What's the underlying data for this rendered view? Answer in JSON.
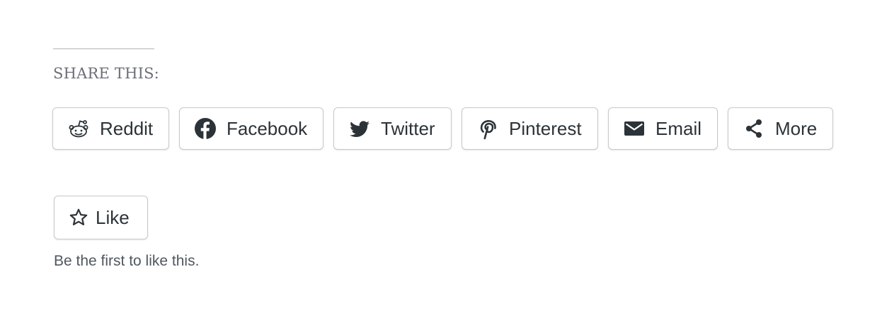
{
  "share": {
    "heading": "SHARE THIS:",
    "buttons": [
      {
        "label": "Reddit",
        "icon": "reddit-icon"
      },
      {
        "label": "Facebook",
        "icon": "facebook-icon"
      },
      {
        "label": "Twitter",
        "icon": "twitter-icon"
      },
      {
        "label": "Pinterest",
        "icon": "pinterest-icon"
      },
      {
        "label": "Email",
        "icon": "email-icon"
      },
      {
        "label": "More",
        "icon": "share-icon"
      }
    ]
  },
  "like": {
    "label": "Like",
    "icon": "star-icon",
    "note": "Be the first to like this."
  },
  "colors": {
    "text": "#2c3338",
    "heading": "#6b6f78",
    "border": "#c9c9c9",
    "divider": "#d6d6d6"
  }
}
